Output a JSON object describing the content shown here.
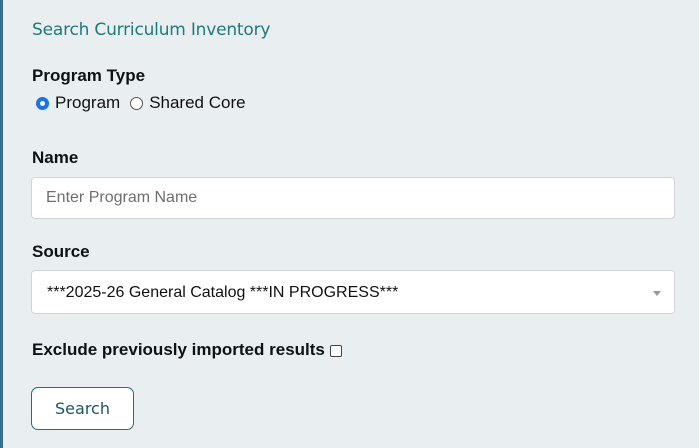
{
  "panel": {
    "title": "Search Curriculum Inventory"
  },
  "program_type": {
    "label": "Program Type",
    "options": [
      {
        "label": "Program",
        "selected": true
      },
      {
        "label": "Shared Core",
        "selected": false
      }
    ]
  },
  "name": {
    "label": "Name",
    "value": "",
    "placeholder": "Enter Program Name"
  },
  "source": {
    "label": "Source",
    "selected_value": "***2025-26 General Catalog ***IN PROGRESS***"
  },
  "exclude": {
    "label": "Exclude previously imported results",
    "checked": false
  },
  "search_button": {
    "label": "Search"
  },
  "colors": {
    "panel_background": "#e9eef1",
    "title_teal": "#1f7a7a",
    "radio_selected": "#1a73e8",
    "button_border": "#2b6b77"
  }
}
